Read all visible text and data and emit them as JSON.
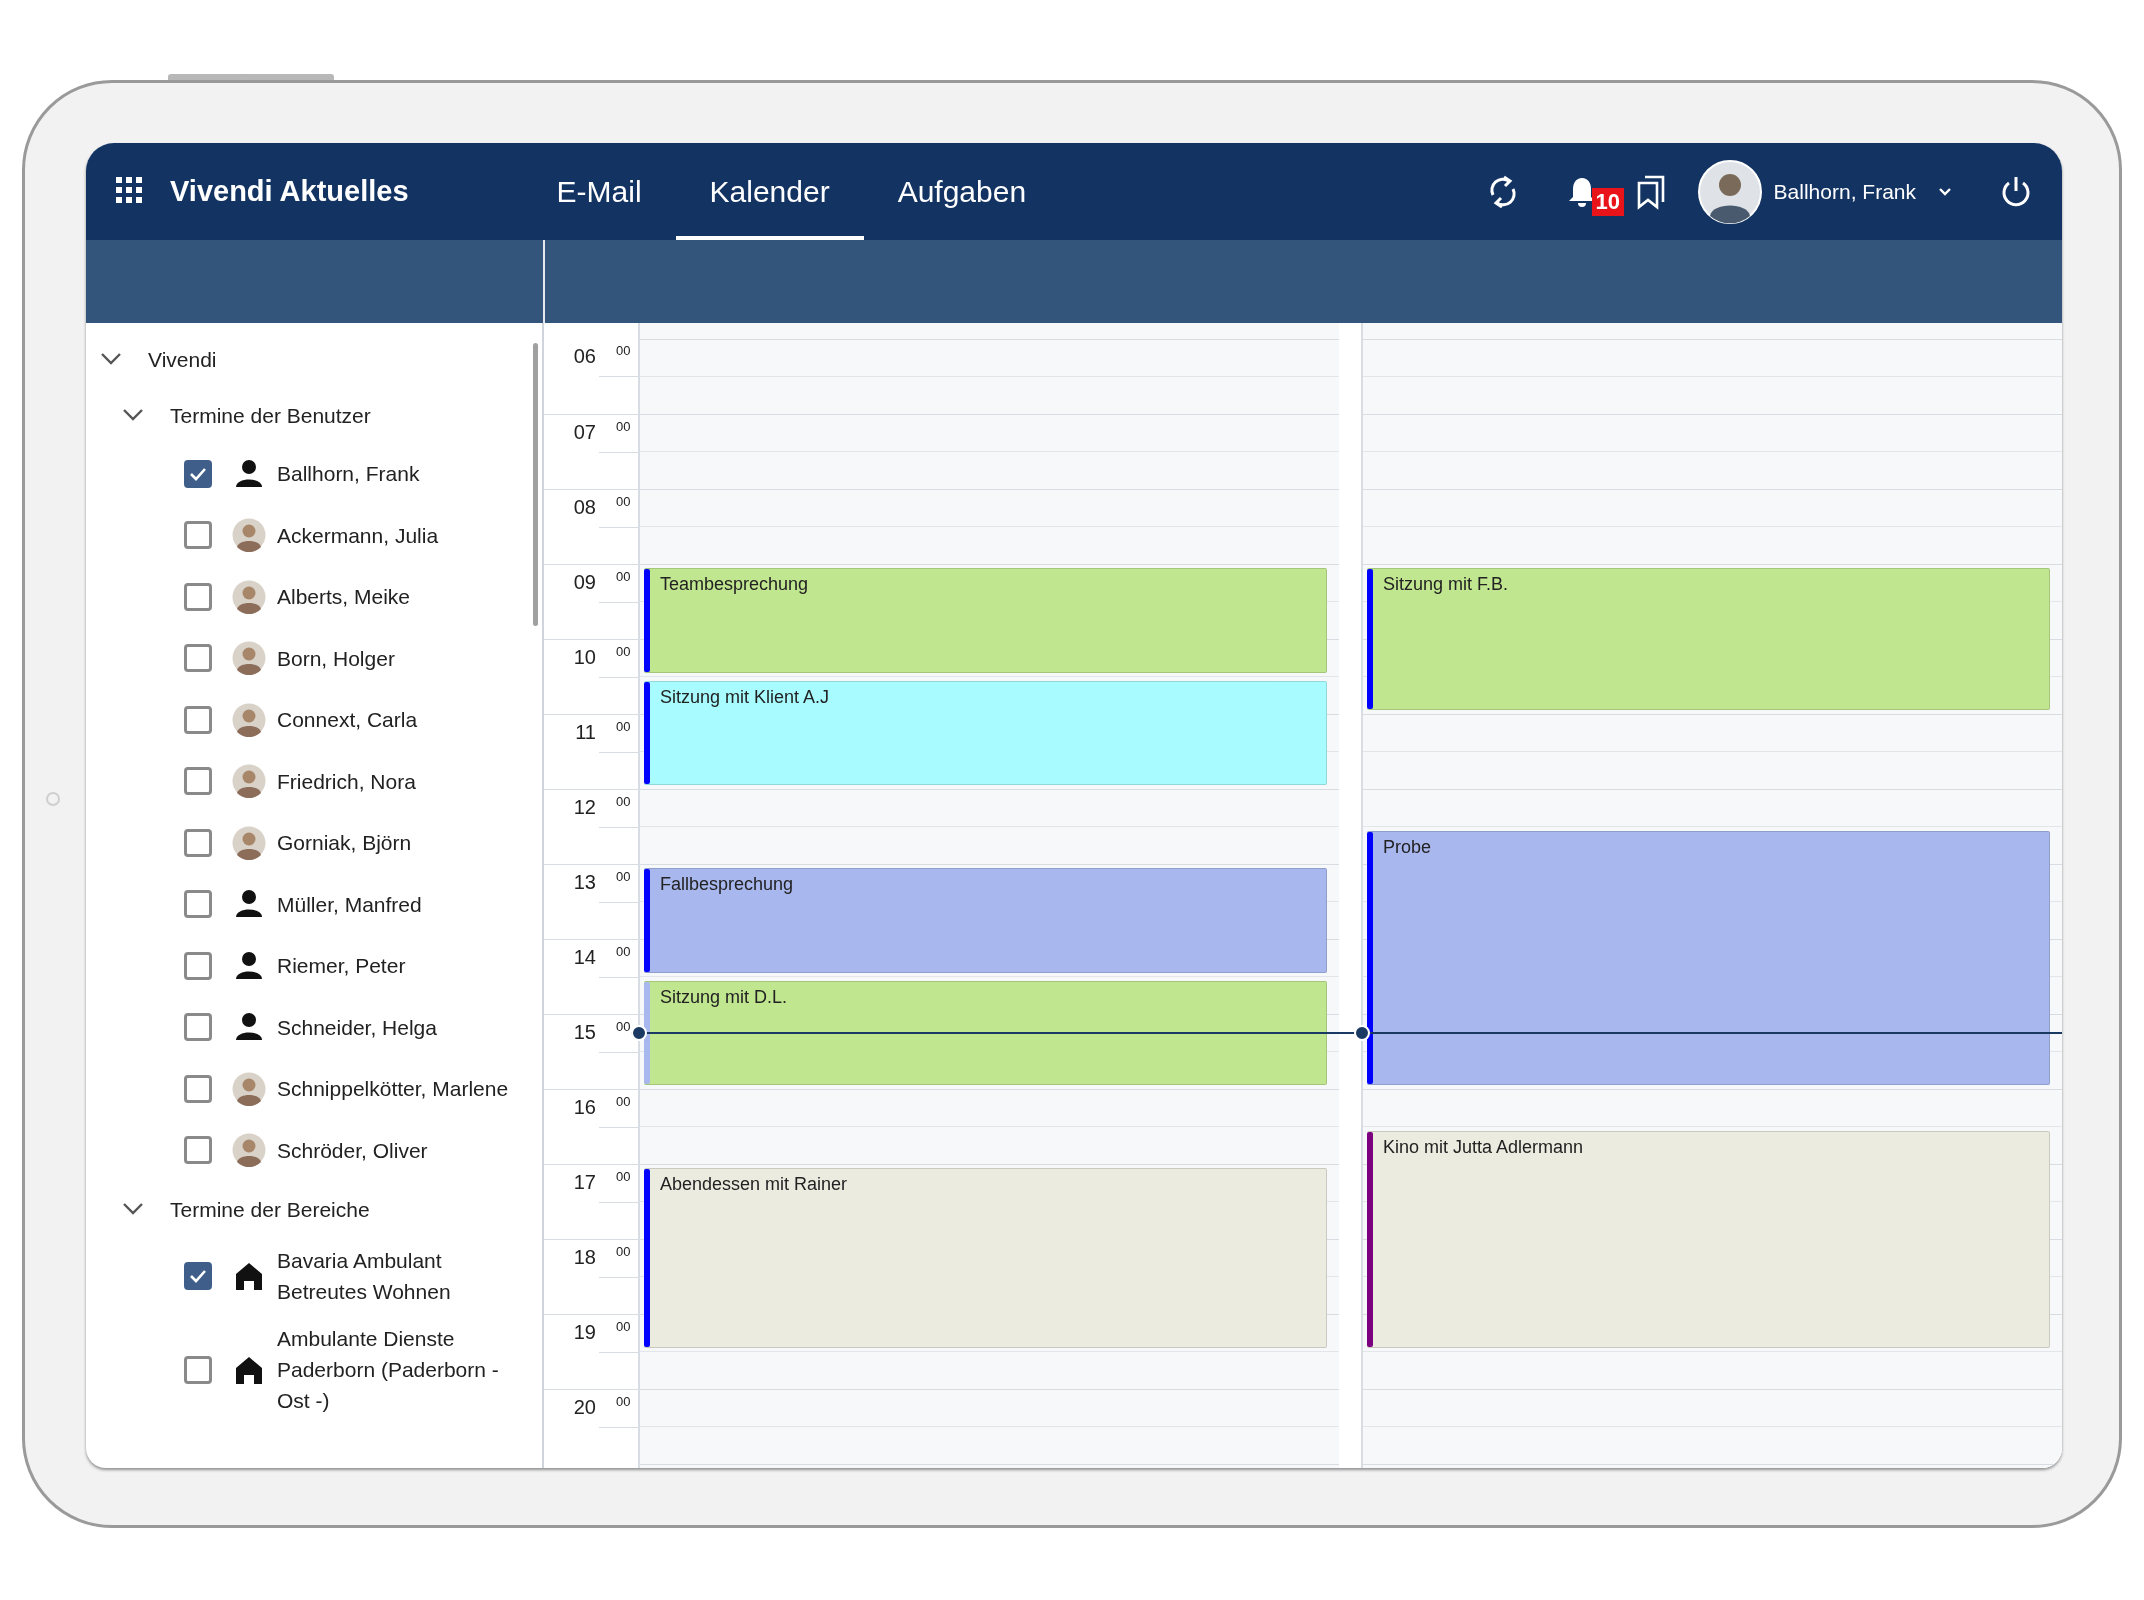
{
  "app": {
    "title": "Vivendi Aktuelles"
  },
  "nav_tabs": [
    {
      "label": "E-Mail",
      "selected": false
    },
    {
      "label": "Kalender",
      "selected": true
    },
    {
      "label": "Aufgaben",
      "selected": false
    }
  ],
  "notifications": {
    "count": "10"
  },
  "user": {
    "name": "Ballhorn, Frank"
  },
  "sidebar": {
    "tree": [
      {
        "label": "Vivendi",
        "expanded": true,
        "children": [
          {
            "label": "Termine der Benutzer",
            "expanded": true,
            "children": [
              {
                "label": "Ballhorn, Frank",
                "checked": true,
                "kind": "person"
              },
              {
                "label": "Ackermann, Julia",
                "checked": false,
                "kind": "photo"
              },
              {
                "label": "Alberts, Meike",
                "checked": false,
                "kind": "photo"
              },
              {
                "label": "Born, Holger",
                "checked": false,
                "kind": "photo"
              },
              {
                "label": "Connext, Carla",
                "checked": false,
                "kind": "photo"
              },
              {
                "label": "Friedrich, Nora",
                "checked": false,
                "kind": "photo"
              },
              {
                "label": "Gorniak, Björn",
                "checked": false,
                "kind": "photo"
              },
              {
                "label": "Müller, Manfred",
                "checked": false,
                "kind": "person"
              },
              {
                "label": "Riemer, Peter",
                "checked": false,
                "kind": "person"
              },
              {
                "label": "Schneider, Helga",
                "checked": false,
                "kind": "person"
              },
              {
                "label": "Schnippelkötter, Marlene",
                "checked": false,
                "kind": "photo"
              },
              {
                "label": "Schröder, Oliver",
                "checked": false,
                "kind": "photo"
              }
            ]
          },
          {
            "label": "Termine der Bereiche",
            "expanded": true,
            "children": [
              {
                "label": "Bavaria Ambulant Betreutes Wohnen",
                "checked": true,
                "kind": "area"
              },
              {
                "label": "Ambulante Dienste Paderborn (Paderborn - Ost -)",
                "checked": false,
                "kind": "area"
              }
            ]
          }
        ]
      }
    ]
  },
  "calendar": {
    "hours": [
      {
        "hour": "06",
        "minutes": "00"
      },
      {
        "hour": "07",
        "minutes": "00"
      },
      {
        "hour": "08",
        "minutes": "00"
      },
      {
        "hour": "09",
        "minutes": "00"
      },
      {
        "hour": "10",
        "minutes": "00"
      },
      {
        "hour": "11",
        "minutes": "00"
      },
      {
        "hour": "12",
        "minutes": "00"
      },
      {
        "hour": "13",
        "minutes": "00"
      },
      {
        "hour": "14",
        "minutes": "00"
      },
      {
        "hour": "15",
        "minutes": "00"
      },
      {
        "hour": "16",
        "minutes": "00"
      },
      {
        "hour": "17",
        "minutes": "00"
      },
      {
        "hour": "18",
        "minutes": "00"
      },
      {
        "hour": "19",
        "minutes": "00"
      },
      {
        "hour": "20",
        "minutes": "00"
      }
    ],
    "days": [
      {
        "events": [
          {
            "title": "Teambesprechung",
            "color": "#c1e690",
            "kind": "standard"
          },
          {
            "title": "Sitzung mit Klient A.J",
            "color": "#a8fcff",
            "kind": "standard"
          },
          {
            "title": "Fallbesprechung",
            "color": "#a8b8ee",
            "kind": "standard"
          },
          {
            "title": "Sitzung mit D.L.",
            "color": "#c1e690",
            "kind": "overlapping"
          },
          {
            "title": "Abendessen mit Rainer",
            "color": "#ebebe0",
            "kind": "standard"
          }
        ]
      },
      {
        "events": [
          {
            "title": "Sitzung mit F.B.",
            "color": "#c1e690",
            "kind": "standard"
          },
          {
            "title": "Probe",
            "color": "#a8b8ee",
            "kind": "standard"
          },
          {
            "title": "Kino mit Jutta Adlermann",
            "color": "#ebebe0",
            "kind": "alternate"
          }
        ]
      }
    ]
  }
}
